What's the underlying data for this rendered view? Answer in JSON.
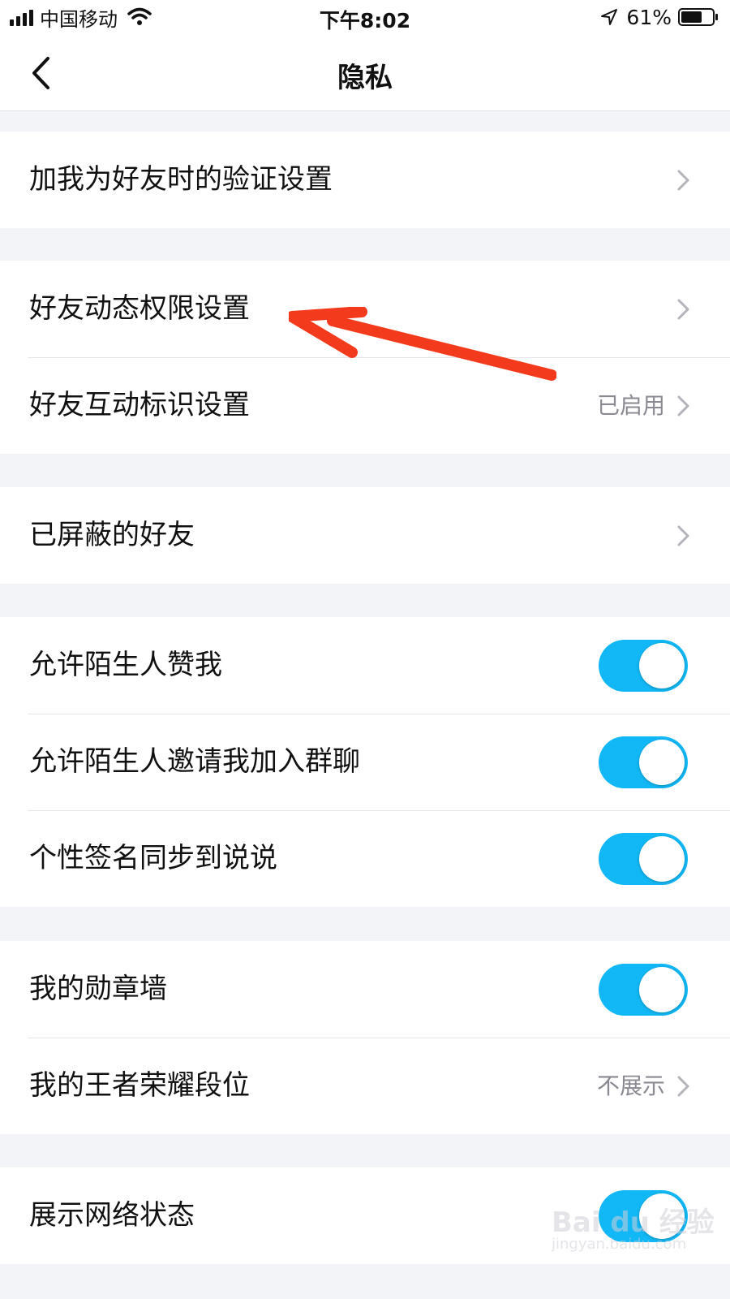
{
  "status_bar": {
    "carrier": "中国移动",
    "time": "下午8:02",
    "battery_percent": "61%",
    "icons": [
      "signal-icon",
      "wifi-icon",
      "location-arrow-icon",
      "battery-icon"
    ]
  },
  "nav": {
    "title": "隐私",
    "back_icon": "chevron-left-icon"
  },
  "groups": [
    {
      "rows": [
        {
          "label": "加我为好友时的验证设置",
          "type": "link"
        }
      ]
    },
    {
      "rows": [
        {
          "label": "好友动态权限设置",
          "type": "link"
        },
        {
          "label": "好友互动标识设置",
          "type": "link",
          "value": "已启用"
        }
      ]
    },
    {
      "rows": [
        {
          "label": "已屏蔽的好友",
          "type": "link"
        }
      ]
    },
    {
      "rows": [
        {
          "label": "允许陌生人赞我",
          "type": "toggle",
          "on": true
        },
        {
          "label": "允许陌生人邀请我加入群聊",
          "type": "toggle",
          "on": true
        },
        {
          "label": "个性签名同步到说说",
          "type": "toggle",
          "on": true
        }
      ]
    },
    {
      "rows": [
        {
          "label": "我的勋章墙",
          "type": "toggle",
          "on": true
        },
        {
          "label": "我的王者荣耀段位",
          "type": "link",
          "value": "不展示"
        }
      ]
    },
    {
      "rows": [
        {
          "label": "展示网络状态",
          "type": "toggle",
          "on": true
        }
      ]
    }
  ],
  "colors": {
    "accent": "#12b7f5",
    "background": "#f3f4f8",
    "annotation": "#f43a1c"
  },
  "watermark": {
    "text": "Bai du 经验",
    "url": "jingyan.baidu.com"
  }
}
